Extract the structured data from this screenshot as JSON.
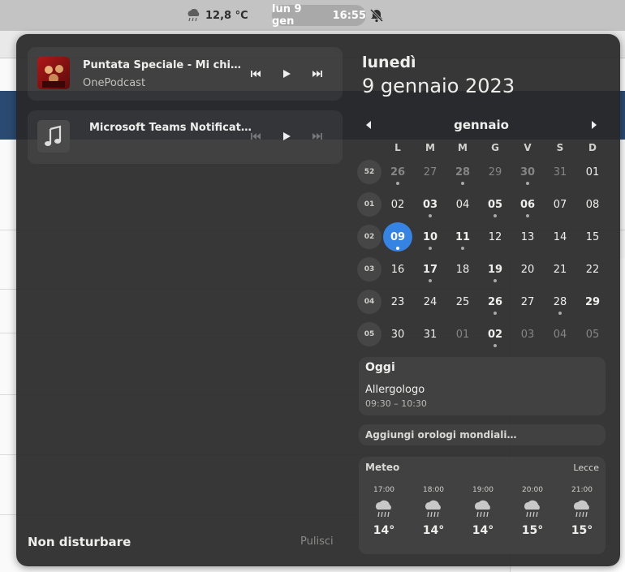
{
  "topbar": {
    "weather_temp": "12,8 °C",
    "date": "lun 9 gen",
    "time": "16:55"
  },
  "media": [
    {
      "title": "Puntata Speciale -  Mi chiam…",
      "subtitle": "OnePodcast"
    },
    {
      "title": "Microsoft Teams Notification",
      "subtitle": ""
    }
  ],
  "calendar": {
    "weekday": "lunedì",
    "full_date": "9 gennaio 2023",
    "month": "gennaio",
    "day_headers": [
      "L",
      "M",
      "M",
      "G",
      "V",
      "S",
      "D"
    ],
    "weeks": [
      {
        "num": "52",
        "days": [
          {
            "d": "26",
            "other": true,
            "bold": true,
            "dot": true
          },
          {
            "d": "27",
            "other": true,
            "bold": false,
            "dot": false
          },
          {
            "d": "28",
            "other": true,
            "bold": true,
            "dot": true
          },
          {
            "d": "29",
            "other": true,
            "bold": false,
            "dot": false
          },
          {
            "d": "30",
            "other": true,
            "bold": true,
            "dot": true
          },
          {
            "d": "31",
            "other": true,
            "bold": false,
            "dot": false
          },
          {
            "d": "01",
            "other": false,
            "bold": false,
            "dot": false
          }
        ]
      },
      {
        "num": "01",
        "days": [
          {
            "d": "02",
            "other": false,
            "bold": false,
            "dot": false
          },
          {
            "d": "03",
            "other": false,
            "bold": true,
            "dot": true
          },
          {
            "d": "04",
            "other": false,
            "bold": false,
            "dot": false
          },
          {
            "d": "05",
            "other": false,
            "bold": true,
            "dot": true
          },
          {
            "d": "06",
            "other": false,
            "bold": true,
            "dot": true
          },
          {
            "d": "07",
            "other": false,
            "bold": false,
            "dot": false
          },
          {
            "d": "08",
            "other": false,
            "bold": false,
            "dot": false
          }
        ]
      },
      {
        "num": "02",
        "days": [
          {
            "d": "09",
            "other": false,
            "bold": true,
            "dot": true,
            "today": true
          },
          {
            "d": "10",
            "other": false,
            "bold": true,
            "dot": true
          },
          {
            "d": "11",
            "other": false,
            "bold": true,
            "dot": true
          },
          {
            "d": "12",
            "other": false,
            "bold": false,
            "dot": false
          },
          {
            "d": "13",
            "other": false,
            "bold": false,
            "dot": false
          },
          {
            "d": "14",
            "other": false,
            "bold": false,
            "dot": false
          },
          {
            "d": "15",
            "other": false,
            "bold": false,
            "dot": false
          }
        ]
      },
      {
        "num": "03",
        "days": [
          {
            "d": "16",
            "other": false,
            "bold": false,
            "dot": false
          },
          {
            "d": "17",
            "other": false,
            "bold": true,
            "dot": true
          },
          {
            "d": "18",
            "other": false,
            "bold": false,
            "dot": false
          },
          {
            "d": "19",
            "other": false,
            "bold": true,
            "dot": true
          },
          {
            "d": "20",
            "other": false,
            "bold": false,
            "dot": false
          },
          {
            "d": "21",
            "other": false,
            "bold": false,
            "dot": false
          },
          {
            "d": "22",
            "other": false,
            "bold": false,
            "dot": false
          }
        ]
      },
      {
        "num": "04",
        "days": [
          {
            "d": "23",
            "other": false,
            "bold": false,
            "dot": false
          },
          {
            "d": "24",
            "other": false,
            "bold": false,
            "dot": false
          },
          {
            "d": "25",
            "other": false,
            "bold": false,
            "dot": false
          },
          {
            "d": "26",
            "other": false,
            "bold": true,
            "dot": true
          },
          {
            "d": "27",
            "other": false,
            "bold": false,
            "dot": false
          },
          {
            "d": "28",
            "other": false,
            "bold": false,
            "dot": true
          },
          {
            "d": "29",
            "other": false,
            "bold": true,
            "dot": false
          }
        ]
      },
      {
        "num": "05",
        "days": [
          {
            "d": "30",
            "other": false,
            "bold": false,
            "dot": false
          },
          {
            "d": "31",
            "other": false,
            "bold": false,
            "dot": false
          },
          {
            "d": "01",
            "other": true,
            "bold": false,
            "dot": false
          },
          {
            "d": "02",
            "other": false,
            "bold": true,
            "dot": true
          },
          {
            "d": "03",
            "other": true,
            "bold": false,
            "dot": false
          },
          {
            "d": "04",
            "other": true,
            "bold": false,
            "dot": false
          },
          {
            "d": "05",
            "other": true,
            "bold": false,
            "dot": false
          }
        ]
      }
    ]
  },
  "events": {
    "title": "Oggi",
    "items": [
      {
        "name": "Allergologo",
        "time": "09:30 – 10:30"
      }
    ]
  },
  "world_clocks": {
    "label": "Aggiungi orologi mondiali…"
  },
  "weather": {
    "title": "Meteo",
    "location": "Lecce",
    "forecast": [
      {
        "time": "17:00",
        "temp": "14°",
        "icon": "rain-icon"
      },
      {
        "time": "18:00",
        "temp": "14°",
        "icon": "rain-icon"
      },
      {
        "time": "19:00",
        "temp": "14°",
        "icon": "rain-icon"
      },
      {
        "time": "20:00",
        "temp": "15°",
        "icon": "rain-icon"
      },
      {
        "time": "21:00",
        "temp": "15°",
        "icon": "rain-icon"
      }
    ]
  },
  "footer": {
    "dnd_label": "Non disturbare",
    "clear_label": "Pulisci"
  },
  "colors": {
    "accent": "#3584e4",
    "panel": "#282828"
  }
}
